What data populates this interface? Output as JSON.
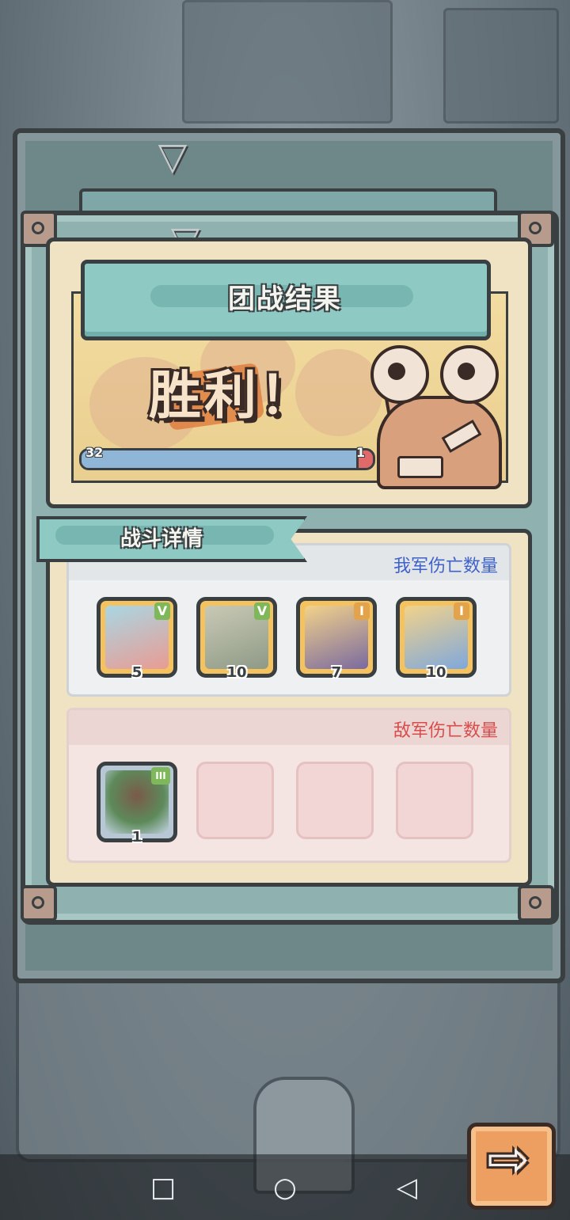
{
  "header": {
    "title": "团战结果"
  },
  "result": {
    "victory_text": "胜利！",
    "progress_left": "32",
    "progress_right": "1",
    "progress_fraction": 0.97
  },
  "details": {
    "title": "战斗详情",
    "ally_section": {
      "label": "我军伤亡数量",
      "units": [
        {
          "icon": "snail-warrior-icon",
          "rank": "V",
          "count": "5"
        },
        {
          "icon": "masked-warrior-icon",
          "rank": "V",
          "count": "10"
        },
        {
          "icon": "purple-blob-icon",
          "rank": "I",
          "count": "7"
        },
        {
          "icon": "blue-cat-icon",
          "rank": "I",
          "count": "10"
        }
      ]
    },
    "enemy_section": {
      "label": "敌军伤亡数量",
      "units": [
        {
          "icon": "brain-monster-icon",
          "rank": "III",
          "count": "1"
        }
      ]
    }
  },
  "nav": {
    "recent_icon": "□",
    "home_icon": "○",
    "back_icon": "◁",
    "next_icon": "⇨"
  },
  "colors": {
    "accent_teal": "#8ec9c4",
    "ally_label": "#3f62c9",
    "enemy_label": "#d84c4c",
    "rank_green": "#7fb85a",
    "rank_orange": "#e3a34b"
  }
}
